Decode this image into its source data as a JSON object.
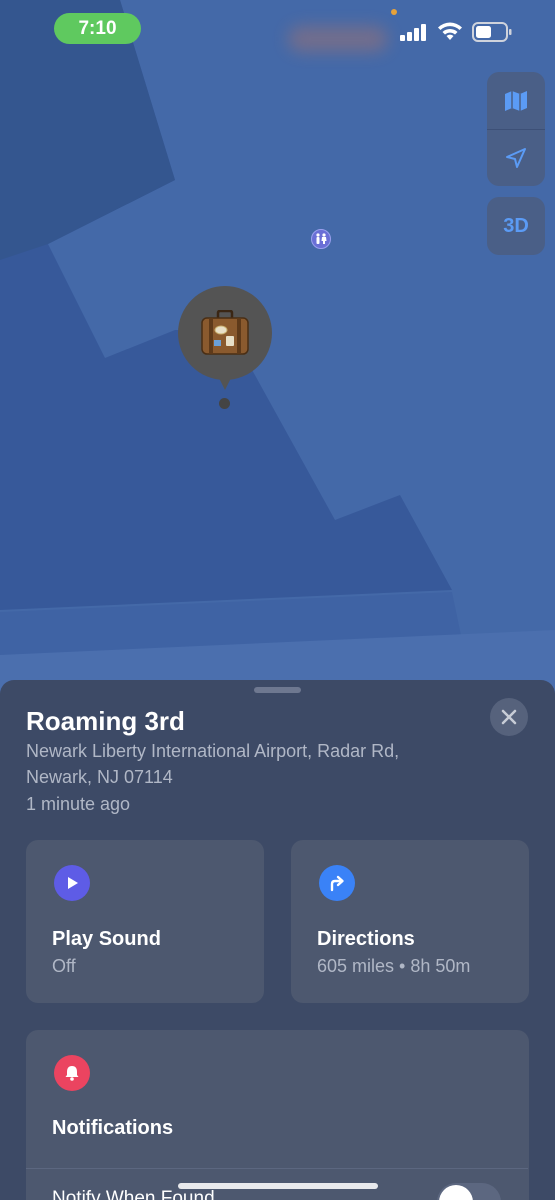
{
  "status_bar": {
    "time": "7:10",
    "colors": {
      "time_pill": "#5fc95f",
      "indicator_dot": "#e7a23a"
    },
    "icons": [
      "cellular-signal-icon",
      "wifi-icon",
      "battery-icon"
    ]
  },
  "map": {
    "controls": {
      "map_icon": "map-icon",
      "location_icon": "location-arrow-icon",
      "view_3d_label": "3D"
    },
    "poi_icon": "restroom-icon",
    "pin_icon": "suitcase-icon"
  },
  "sheet": {
    "title": "Roaming 3rd",
    "address_line1": "Newark Liberty International Airport, Radar Rd,",
    "address_line2": "Newark, NJ  07114",
    "last_seen": "1 minute ago",
    "play_sound": {
      "label": "Play Sound",
      "status": "Off",
      "icon_color": "#5e5ce6"
    },
    "directions": {
      "label": "Directions",
      "detail": "605 miles • 8h 50m",
      "icon_color": "#3a82f7"
    },
    "notifications": {
      "label": "Notifications",
      "icon_color": "#eb4460",
      "notify_when_found": "Notify When Found",
      "notify_when_found_on": false
    }
  }
}
